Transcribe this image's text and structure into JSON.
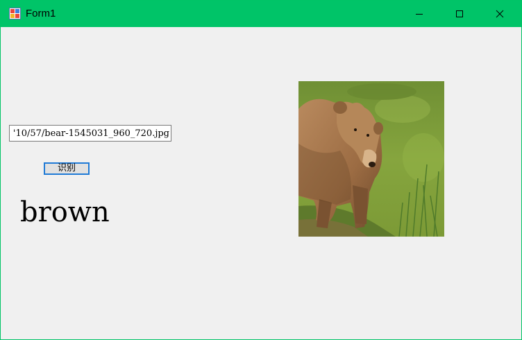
{
  "window": {
    "title": "Form1"
  },
  "form": {
    "path_value": "'10/57/bear-1545031_960_720.jpg",
    "recognize_label": "识别",
    "result_text": "brown"
  },
  "picture": {
    "subject": "brown-bear-photo"
  },
  "colors": {
    "titlebar": "#00c468",
    "window_bg": "#f0f0f0",
    "button_border": "#1f7ad6"
  },
  "icons": {
    "app": "app-icon",
    "minimize": "minimize-icon",
    "maximize": "maximize-icon",
    "close": "close-icon"
  }
}
